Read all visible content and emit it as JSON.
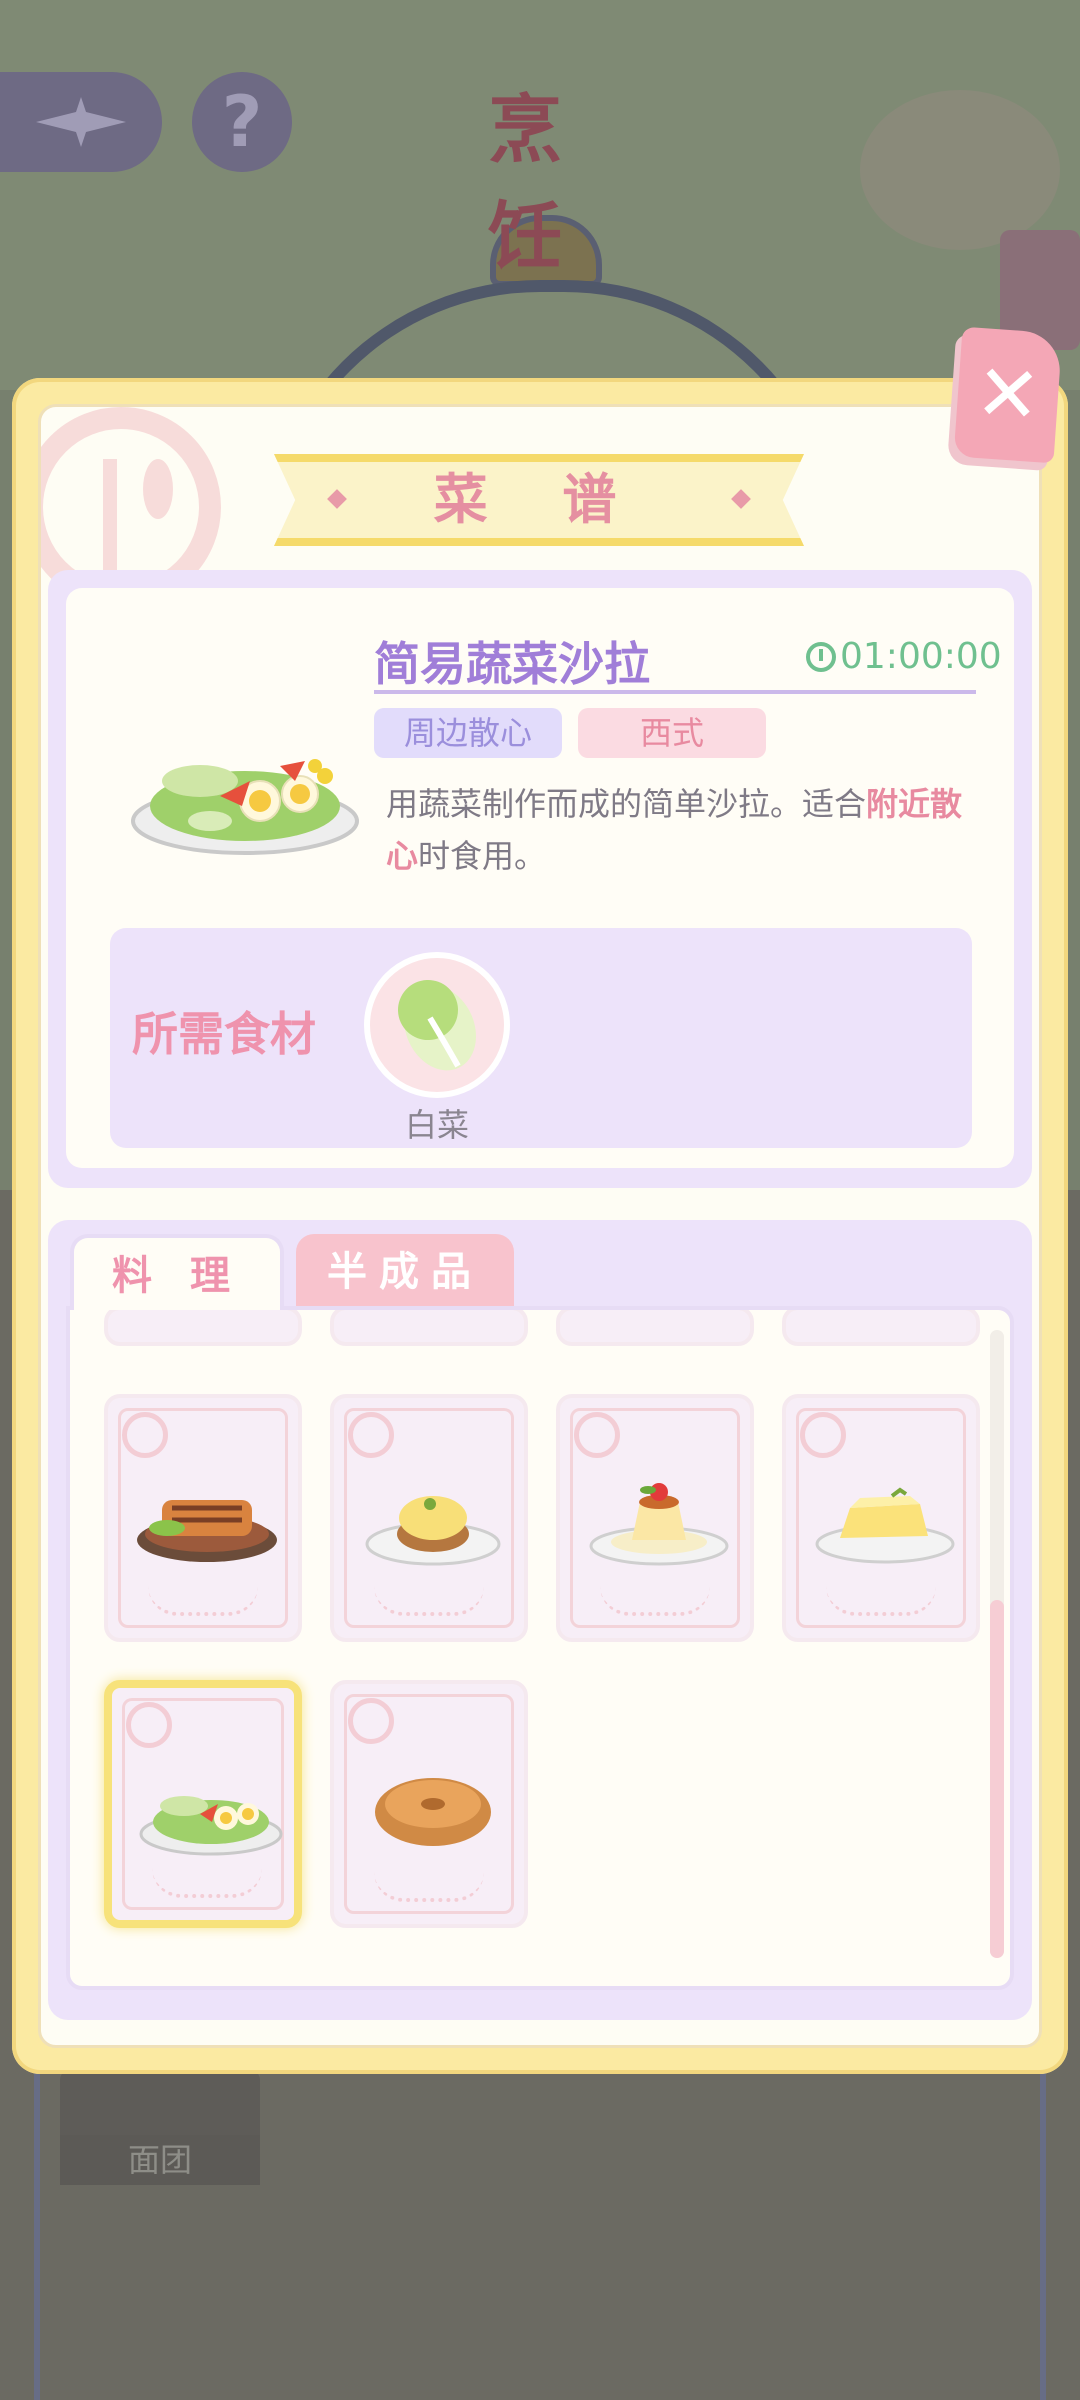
{
  "header": {
    "title": "烹 饪",
    "help_label": "?",
    "back_icon": "compass-back-icon"
  },
  "background": {
    "ingredient_label": "面团"
  },
  "modal": {
    "title": "菜 谱",
    "close_label": "✕"
  },
  "recipe": {
    "name": "简易蔬菜沙拉",
    "time": "01:00:00",
    "tags": [
      "周边散心",
      "西式"
    ],
    "description_prefix": "用蔬菜制作而成的简单沙拉。适合",
    "description_highlight": "附近散心",
    "description_suffix": "时食用。",
    "ingredients_label": "所需食材",
    "ingredients": [
      {
        "name": "白菜",
        "icon": "cabbage-icon"
      }
    ]
  },
  "tabs": [
    {
      "label": "料 理",
      "active": true
    },
    {
      "label": "半成品",
      "active": false
    }
  ],
  "dishes": [
    {
      "icon": "glazed-pork-icon",
      "selected": false
    },
    {
      "icon": "eggs-benedict-icon",
      "selected": false
    },
    {
      "icon": "pudding-icon",
      "selected": false
    },
    {
      "icon": "cheese-icon",
      "selected": false
    },
    {
      "icon": "vegetable-salad-icon",
      "selected": true
    },
    {
      "icon": "bagel-icon",
      "selected": false
    }
  ],
  "colors": {
    "accent_pink": "#ef93ad",
    "accent_purple": "#a07ed8",
    "timer_green": "#6fc08f",
    "modal_border": "#fbeaa2"
  }
}
